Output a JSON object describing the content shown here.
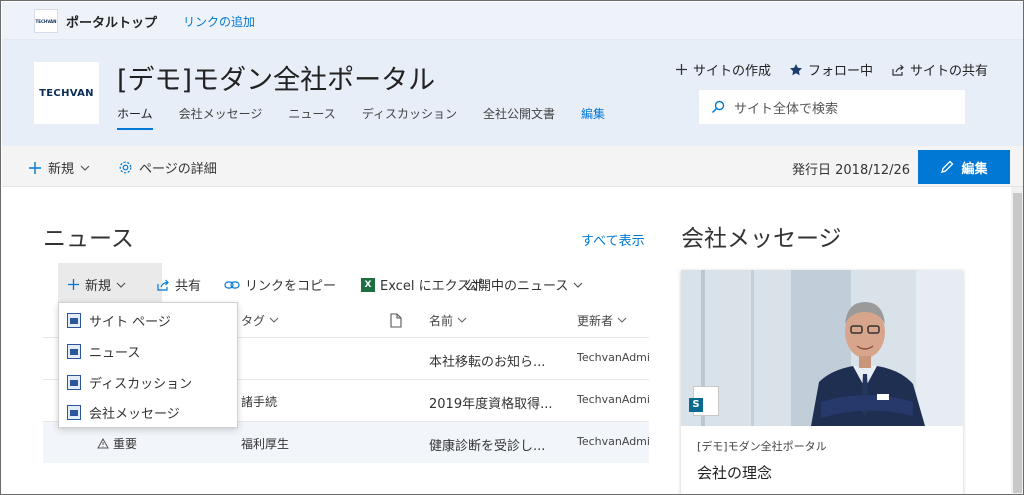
{
  "suite_bar": {
    "logo_text": "TECHVAN",
    "title": "ポータルトップ",
    "add_link": "リンクの追加"
  },
  "site": {
    "logo_text": "TECHVAN",
    "title": "[デモ]モダン全社ポータル",
    "nav": [
      {
        "label": "ホーム"
      },
      {
        "label": "会社メッセージ"
      },
      {
        "label": "ニュース"
      },
      {
        "label": "ディスカッション"
      },
      {
        "label": "全社公開文書"
      },
      {
        "label": "編集"
      }
    ],
    "actions": {
      "create_site": "サイトの作成",
      "follow": "フォロー中",
      "share_site": "サイトの共有"
    },
    "search_placeholder": "サイト全体で検索"
  },
  "command_bar": {
    "new_label": "新規",
    "page_details": "ページの詳細",
    "published": "発行日 2018/12/26",
    "edit": "編集"
  },
  "news": {
    "title": "ニュース",
    "see_all": "すべて表示",
    "list_commands": {
      "new": "新規",
      "share": "共有",
      "copy_link": "リンクをコピー",
      "export": "Excel にエクスポ",
      "view": "公開中のニュース"
    },
    "columns": {
      "tag": "タグ",
      "name": "名前",
      "updated_by": "更新者"
    },
    "rows": [
      {
        "flag": "",
        "tag": "",
        "name": "本社移転のお知ら...",
        "updated_by": "TechvanAdmi"
      },
      {
        "flag": "",
        "tag": "諸手続",
        "name": "2019年度資格取得...",
        "updated_by": "TechvanAdmi"
      },
      {
        "flag": "重要",
        "tag": "福利厚生",
        "name": "健康診断を受診し...",
        "updated_by": "TechvanAdmi"
      }
    ],
    "new_menu": [
      {
        "label": "サイト ページ"
      },
      {
        "label": "ニュース"
      },
      {
        "label": "ディスカッション"
      },
      {
        "label": "会社メッセージ"
      }
    ]
  },
  "company_message": {
    "title": "会社メッセージ",
    "card": {
      "site": "[デモ]モダン全社ポータル",
      "headline": "会社の理念"
    }
  },
  "colors": {
    "accent": "#0078d4",
    "header_bg": "#e7eef8",
    "suite_bg": "#eef3fa",
    "command_bg": "#f4f4f4"
  }
}
